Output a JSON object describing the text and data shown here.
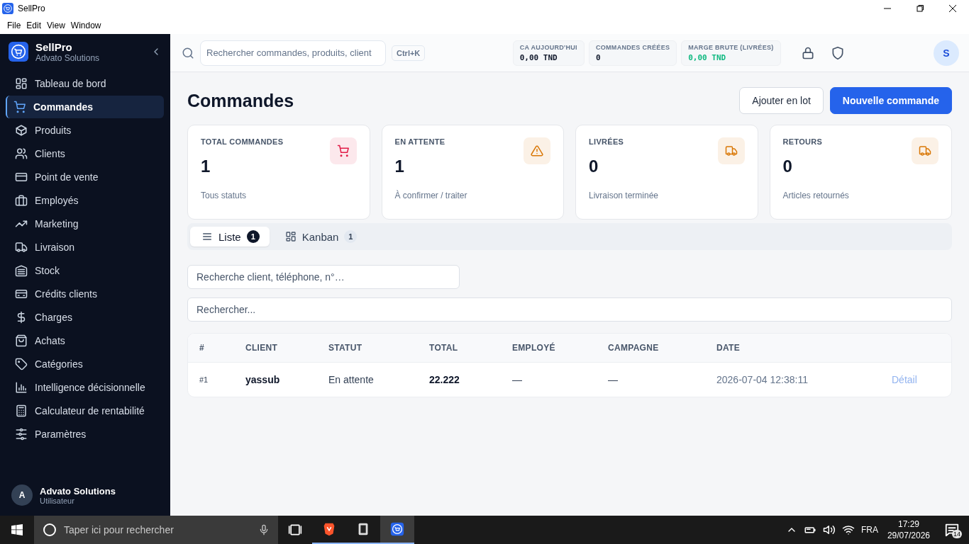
{
  "window": {
    "title": "SellPro"
  },
  "menu": [
    "File",
    "Edit",
    "View",
    "Window"
  ],
  "brand": {
    "name": "SellPro",
    "subtitle": "Advato Solutions"
  },
  "sidebar": {
    "items": [
      {
        "label": "Tableau de bord",
        "selected": false
      },
      {
        "label": "Commandes",
        "selected": true
      },
      {
        "label": "Produits",
        "selected": false
      },
      {
        "label": "Clients",
        "selected": false
      },
      {
        "label": "Point de vente",
        "selected": false
      },
      {
        "label": "Employés",
        "selected": false
      },
      {
        "label": "Marketing",
        "selected": false
      },
      {
        "label": "Livraison",
        "selected": false
      },
      {
        "label": "Stock",
        "selected": false
      },
      {
        "label": "Crédits clients",
        "selected": false
      },
      {
        "label": "Charges",
        "selected": false
      },
      {
        "label": "Achats",
        "selected": false
      },
      {
        "label": "Catégories",
        "selected": false
      },
      {
        "label": "Intelligence décisionnelle",
        "selected": false
      },
      {
        "label": "Calculateur de rentabilité",
        "selected": false
      },
      {
        "label": "Paramètres",
        "selected": false
      }
    ]
  },
  "user": {
    "initial": "A",
    "name": "Advato Solutions",
    "role": "Utilisateur"
  },
  "topbar": {
    "search": {
      "placeholder": "Rechercher commandes, produits, client"
    },
    "shortcut": "Ctrl+K",
    "stats": [
      {
        "label": "CA AUJOURD'HUI",
        "value": "0,00 TND",
        "kind": "neutral"
      },
      {
        "label": "COMMANDES CRÉÉES",
        "value": "0",
        "kind": "neutral"
      },
      {
        "label": "MARGE BRUTE (LIVRÉES)",
        "value": "0,00 TND",
        "kind": "positive"
      }
    ],
    "avatar": "S"
  },
  "page": {
    "title": "Commandes",
    "buttons": [
      {
        "label": "Ajouter en lot",
        "kind": "secondary"
      },
      {
        "label": "Nouvelle commande",
        "kind": "primary"
      }
    ]
  },
  "cards": [
    {
      "label": "TOTAL COMMANDES",
      "value": "1",
      "caption": "Tous statuts",
      "color": "#e11d48"
    },
    {
      "label": "EN ATTENTE",
      "value": "1",
      "caption": "À confirmer / traiter",
      "color": "#d97706"
    },
    {
      "label": "LIVRÉES",
      "value": "0",
      "caption": "Livraison terminée",
      "color": "#d97706"
    },
    {
      "label": "RETOURS",
      "value": "0",
      "caption": "Articles retournés",
      "color": "#d97706"
    }
  ],
  "view_tabs": [
    {
      "label": "Liste",
      "count": "1",
      "selected": true
    },
    {
      "label": "Kanban",
      "count": "1",
      "selected": false
    }
  ],
  "filters": [
    {
      "placeholder": "Recherche client, téléphone, n°…"
    },
    {
      "placeholder": "Rechercher..."
    }
  ],
  "table": {
    "columns": [
      "#",
      "CLIENT",
      "STATUT",
      "TOTAL",
      "EMPLOYÉ",
      "CAMPAGNE",
      "DATE"
    ],
    "rows": [
      {
        "cells": [
          "#1",
          "yassub",
          "En attente",
          "22.222",
          "—",
          "—",
          "2026-07-04 12:38:11"
        ],
        "action": "Détail"
      }
    ]
  },
  "taskbar": {
    "search_placeholder": "Taper ici pour rechercher",
    "apps": [
      {
        "running": true,
        "selected": false
      },
      {
        "running": true,
        "selected": false
      },
      {
        "running": true,
        "selected": true
      }
    ],
    "language": "FRA",
    "time": "17:29",
    "date": "29/07/2026",
    "notifications": "14"
  }
}
